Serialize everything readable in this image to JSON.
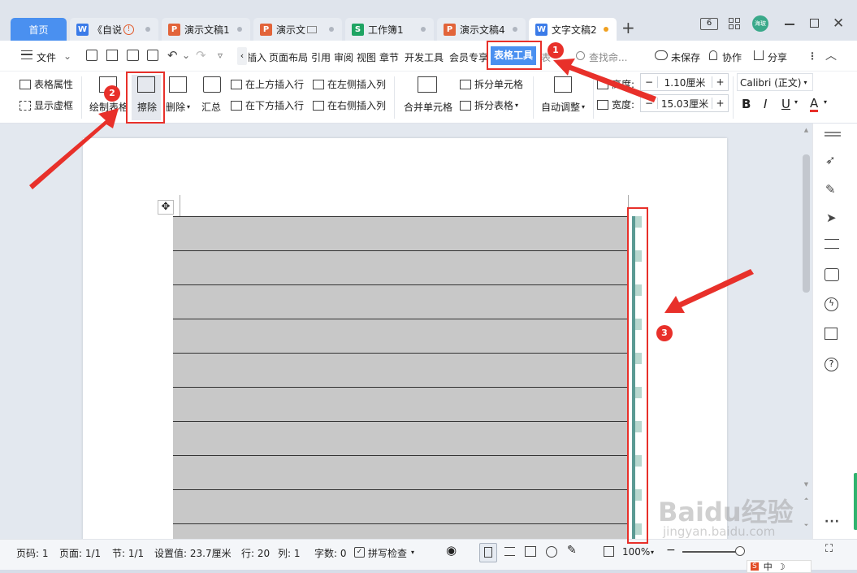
{
  "tabs": [
    {
      "label": "首页"
    },
    {
      "label": "《自说",
      "icon": "W"
    },
    {
      "label": "演示文稿1",
      "icon": "P"
    },
    {
      "label": "演示文",
      "icon": "P"
    },
    {
      "label": "工作簿1",
      "icon": "S"
    },
    {
      "label": "演示文稿4",
      "icon": "P"
    },
    {
      "label": "文字文稿2",
      "icon": "W"
    }
  ],
  "tab_add": "+",
  "window": {
    "badge": "6",
    "avatar": "海玻"
  },
  "menu": {
    "file": "文件",
    "tabs": [
      "插入",
      "页面布局",
      "引用",
      "审阅",
      "视图",
      "章节",
      "开发工具",
      "会员专享",
      "表格工具",
      "表"
    ],
    "search": "查找命...",
    "unsaved": "未保存",
    "collab": "协作",
    "share": "分享"
  },
  "ribbon": {
    "table_props": "表格属性",
    "show_grid": "显示虚框",
    "draw_table": "绘制表格",
    "erase": "擦除",
    "delete": "删除",
    "summary": "汇总",
    "insert_above": "在上方插入行",
    "insert_below": "在下方插入行",
    "insert_left": "在左侧插入列",
    "insert_right": "在右侧插入列",
    "merge_cells": "合并单元格",
    "split_cells": "拆分单元格",
    "split_table": "拆分表格",
    "auto_adjust": "自动调整",
    "height_label": "高度:",
    "height_value": "1.10厘米",
    "width_label": "宽度:",
    "width_value": "15.03厘米",
    "font": "Calibri (正文)",
    "bold": "B",
    "italic": "I",
    "underline": "U",
    "font_color": "A",
    "minus": "−",
    "plus": "+"
  },
  "annotations": [
    "1",
    "2",
    "3"
  ],
  "status": {
    "page_num": "页码: 1",
    "pages": "页面: 1/1",
    "section": "节: 1/1",
    "setting": "设置值: 23.7厘米",
    "row": "行: 20",
    "col": "列: 1",
    "words": "字数: 0",
    "spell": "拼写检查",
    "zoom": "100%"
  },
  "watermark": {
    "brand": "Baidu经验",
    "url": "jingyan.baidu.com"
  },
  "ime": {
    "lang": "中"
  },
  "colors": {
    "accent": "#4a90f0",
    "annotation": "#e8302a",
    "table_fill": "#c8c8c8",
    "border_highlight": "#5b9a94"
  }
}
